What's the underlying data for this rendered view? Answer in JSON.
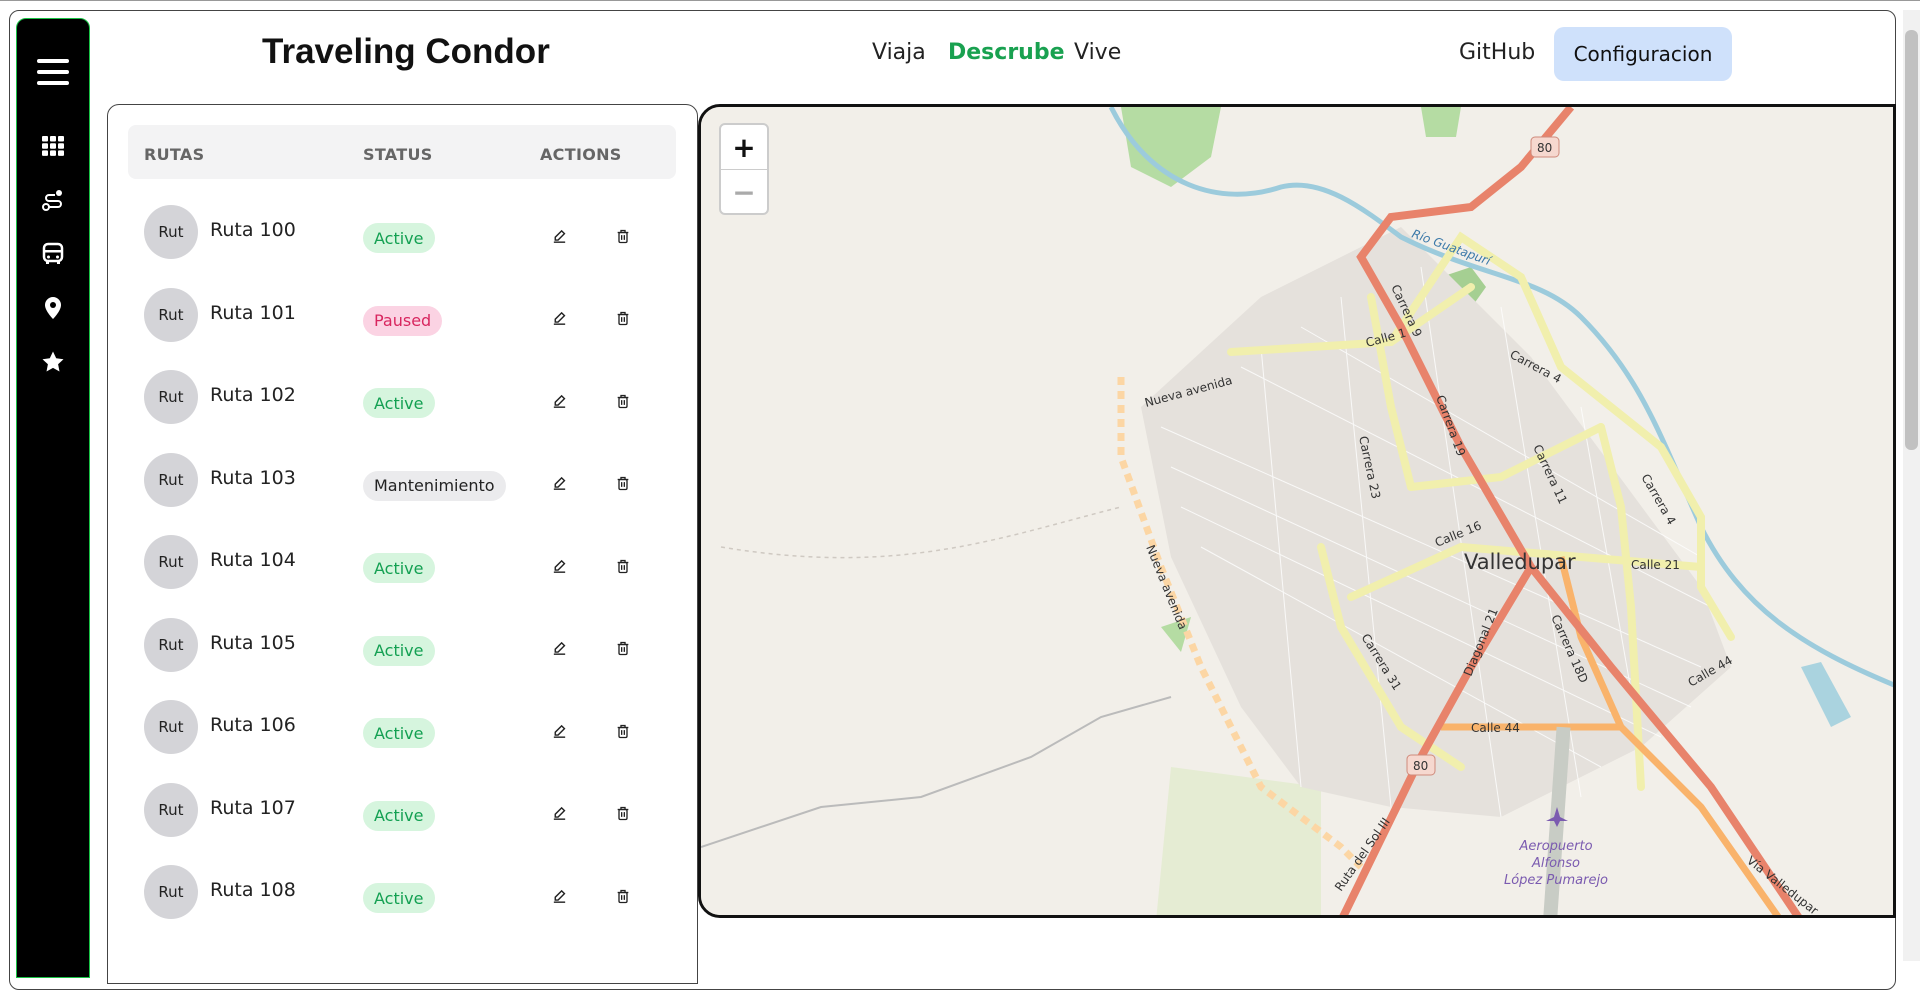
{
  "header": {
    "brand": "Traveling Condor",
    "nav": [
      {
        "label": "Viaja"
      },
      {
        "label": "Descrube"
      },
      {
        "label": "Vive"
      },
      {
        "label": "GitHub"
      }
    ],
    "config_label": "Configuracion",
    "accent": "#19a150"
  },
  "sidebar": {
    "icons": [
      "menu-icon",
      "grid-icon",
      "route-icon",
      "bus-icon",
      "location-pin-icon",
      "star-icon"
    ]
  },
  "table": {
    "headers": [
      "RUTAS",
      "STATUS",
      "ACTIONS"
    ],
    "rows": [
      {
        "avatar": "Rut",
        "name": "Ruta 100",
        "status": "Active"
      },
      {
        "avatar": "Rut",
        "name": "Ruta 101",
        "status": "Paused"
      },
      {
        "avatar": "Rut",
        "name": "Ruta 102",
        "status": "Active"
      },
      {
        "avatar": "Rut",
        "name": "Ruta 103",
        "status": "Mantenimiento"
      },
      {
        "avatar": "Rut",
        "name": "Ruta 104",
        "status": "Active"
      },
      {
        "avatar": "Rut",
        "name": "Ruta 105",
        "status": "Active"
      },
      {
        "avatar": "Rut",
        "name": "Ruta 106",
        "status": "Active"
      },
      {
        "avatar": "Rut",
        "name": "Ruta 107",
        "status": "Active"
      },
      {
        "avatar": "Rut",
        "name": "Ruta 108",
        "status": "Active"
      }
    ]
  },
  "map": {
    "zoom_in": "+",
    "zoom_out": "−",
    "city": "Valledupar",
    "labels": {
      "route80a": "80",
      "route80b": "80",
      "rio": "Río Guatapurí",
      "calle1": "Calle 1",
      "carrera9": "Carrera 9",
      "carrera19": "Carrera 19",
      "carrera4a": "Carrera 4",
      "carrera4b": "Carrera 4",
      "nueva1": "Nueva avenida",
      "nueva2": "Nueva avenida",
      "carrera23": "Carrera 23",
      "carrera11": "Carrera 11",
      "calle16": "Calle 16",
      "calle21": "Calle 21",
      "carrera31": "Carrera 31",
      "diagonal21": "Diagonal 21",
      "carrera18d": "Carrera 18D",
      "calle44a": "Calle 44",
      "calle44b": "Calle 44",
      "rutasol": "Ruta del Sol III",
      "aero1": "Aeropuerto",
      "aero2": "Alfonso",
      "aero3": "López Pumarejo",
      "via": "Vía Valledupar"
    }
  }
}
